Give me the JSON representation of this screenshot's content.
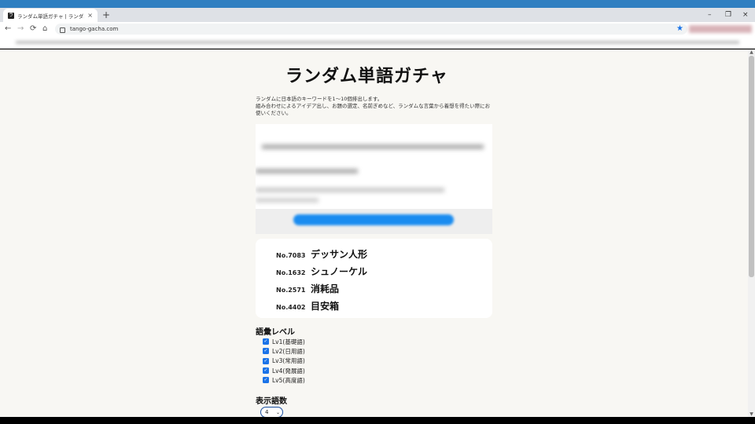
{
  "browser": {
    "tab_title": "ランダム単語ガチャ | ランダムに日本語",
    "tab_favicon_glyph": "ラ",
    "tab_close": "×",
    "new_tab": "+",
    "url": "tango-gacha.com",
    "nav": {
      "back": "←",
      "forward": "→",
      "reload": "⟳",
      "home": "⌂"
    },
    "bookmark_star": "★",
    "window": {
      "minimize": "–",
      "maximize": "❐",
      "close": "×"
    }
  },
  "page": {
    "title": "ランダム単語ガチャ",
    "description_line1": "ランダムに日本語のキーワードを1〜10個排出します。",
    "description_line2": "組み合わせによるアイデア出し、お題の選定、名前ぎめなど、ランダムな言葉から着想を得たい際にお使いください。",
    "results": [
      {
        "no": "No.7083",
        "word": "デッサン人形"
      },
      {
        "no": "No.1632",
        "word": "シュノーケル"
      },
      {
        "no": "No.2571",
        "word": "消耗品"
      },
      {
        "no": "No.4402",
        "word": "目安箱"
      }
    ],
    "level_section_title": "語彙レベル",
    "levels": [
      {
        "label": "Lv1(基礎語)",
        "checked": true
      },
      {
        "label": "Lv2(日用語)",
        "checked": true
      },
      {
        "label": "Lv3(常用語)",
        "checked": true
      },
      {
        "label": "Lv4(発展語)",
        "checked": true
      },
      {
        "label": "Lv5(高度語)",
        "checked": true
      }
    ],
    "count_section_title": "表示語数",
    "count_selected": "4"
  },
  "colors": {
    "accent": "#1a73e8",
    "page_bg": "#f8f7f3",
    "top_strip": "#2f7fc1"
  },
  "icons": {
    "checkmark": "✓",
    "chevron": "⌄",
    "scroll_up": "▲",
    "scroll_down": "▼"
  }
}
